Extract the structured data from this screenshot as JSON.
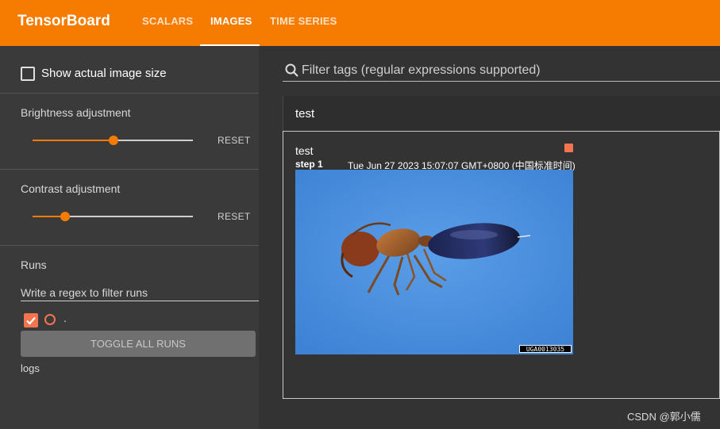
{
  "header": {
    "brand": "TensorBoard",
    "tabs": [
      {
        "label": "SCALARS",
        "active": false
      },
      {
        "label": "IMAGES",
        "active": true
      },
      {
        "label": "TIME SERIES",
        "active": false
      }
    ],
    "accent_color": "#f57c00"
  },
  "sidebar": {
    "show_actual_size_label": "Show actual image size",
    "show_actual_size_checked": false,
    "brightness": {
      "label": "Brightness adjustment",
      "reset_label": "RESET",
      "value": 0.5
    },
    "contrast": {
      "label": "Contrast adjustment",
      "reset_label": "RESET",
      "value": 0.2
    },
    "runs": {
      "label": "Runs",
      "filter_placeholder": "Write a regex to filter runs",
      "items": [
        {
          "name": ".",
          "checked": true,
          "color": "#f4744f"
        }
      ],
      "toggle_label": "TOGGLE ALL RUNS",
      "logdir": "logs"
    }
  },
  "main": {
    "filter_placeholder": "Filter tags (regular expressions supported)",
    "group": {
      "title": "test"
    },
    "card": {
      "title": "test",
      "step_label": "step",
      "step_value": "1",
      "timestamp": "Tue Jun 27 2023 15:07:07 GMT+0800 (中国标准时间)",
      "run_color": "#f4744f",
      "image_caption": "UGA0013035"
    }
  },
  "watermark": "CSDN @郭小儒"
}
